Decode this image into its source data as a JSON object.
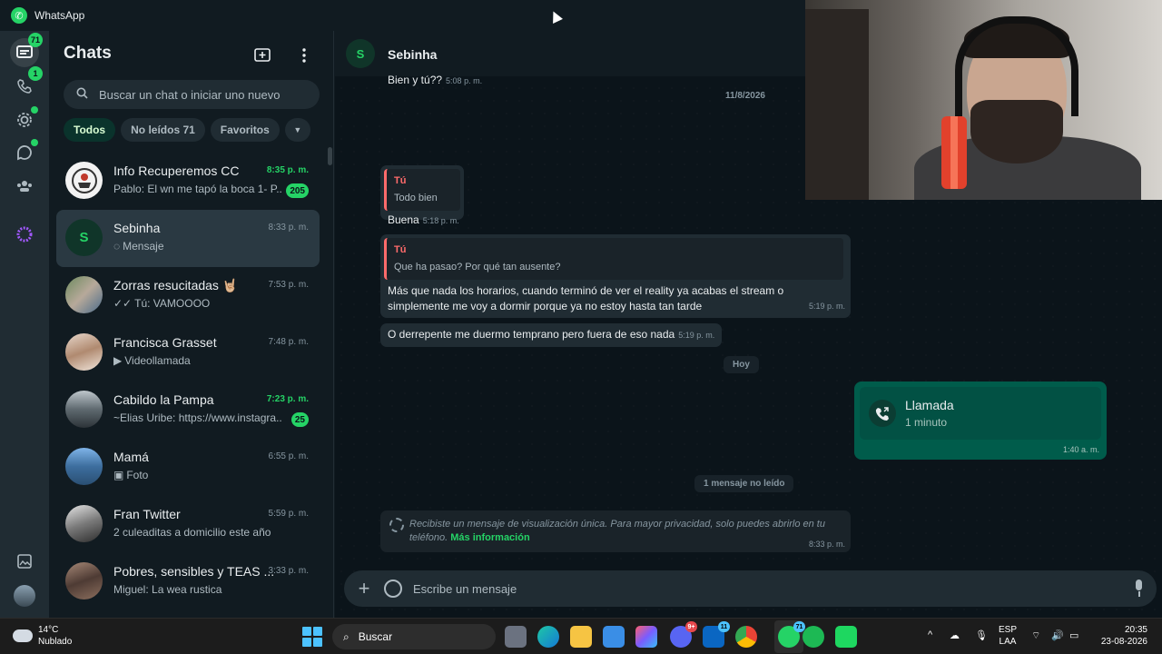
{
  "app": {
    "title": "WhatsApp"
  },
  "rail": {
    "items": [
      {
        "icon": "chats-icon",
        "badge": "71"
      },
      {
        "icon": "phone-icon",
        "badge": "1"
      },
      {
        "icon": "status-icon"
      },
      {
        "icon": "channels-icon"
      },
      {
        "icon": "communities-icon"
      },
      {
        "icon": "meta-ai-icon"
      },
      {
        "icon": "media-icon"
      }
    ]
  },
  "sidebar": {
    "title": "Chats",
    "search_placeholder": "Buscar un chat o iniciar uno nuevo",
    "filters": [
      "Todos",
      "No leídos 71",
      "Favoritos"
    ],
    "chats": [
      {
        "name": "Info Recuperemos CC",
        "time": "8:35 p. m.",
        "preview": "Pablo: El wn me tapó la boca 1- P...",
        "badge": "205",
        "unread": true
      },
      {
        "name": "Sebinha",
        "time": "8:33 p. m.",
        "preview": "Mensaje",
        "preview_icon": "◌",
        "selected": true,
        "letter": "S"
      },
      {
        "name": "Zorras resucitadas 🤘🏼",
        "time": "7:53 p. m.",
        "preview": "Tú: VAMOOOO",
        "preview_icon": "✓✓"
      },
      {
        "name": "Francisca Grasset",
        "time": "7:48 p. m.",
        "preview": "Videollamada",
        "preview_icon": "▶"
      },
      {
        "name": "Cabildo la Pampa",
        "time": "7:23 p. m.",
        "preview": "~Elias Uribe: https://www.instagra...",
        "badge": "25",
        "unread": true
      },
      {
        "name": "Mamá",
        "time": "6:55 p. m.",
        "preview": "Foto",
        "preview_icon": "▣"
      },
      {
        "name": "Fran Twitter",
        "time": "5:59 p. m.",
        "preview": "2 culeaditas a domicilio este año"
      },
      {
        "name": "Pobres, sensibles y TEAS ...",
        "time": "3:33 p. m.",
        "preview": "Miguel: La wea rustica"
      }
    ]
  },
  "conversation": {
    "contact_name": "Sebinha",
    "contact_letter": "S",
    "messages": {
      "m1_text": "Bien y tú??",
      "m1_time": "5:08 p. m.",
      "date1": "11/8/2026",
      "q1_author": "Tú",
      "q1_text": "Todo bien",
      "m2_text": "Buena",
      "m2_time": "5:18 p. m.",
      "q2_author": "Tú",
      "q2_text": "Que ha pasao? Por qué tan ausente?",
      "m3_text": "Más que nada los horarios, cuando terminó de ver el reality ya acabas el stream o simplemente me voy a dormir porque ya no estoy hasta tan tarde",
      "m3_time": "5:19 p. m.",
      "m4_text": "O derrepente me duermo temprano pero fuera de eso nada",
      "m4_time": "5:19 p. m.",
      "date2": "Hoy",
      "call_title": "Llamada",
      "call_duration": "1 minuto",
      "call_time": "1:40 a. m.",
      "unread_divider": "1 mensaje no leído",
      "view_once_text": "Recibiste un mensaje de visualización única. Para mayor privacidad, solo puedes abrirlo en tu teléfono.",
      "view_once_link": "Más información",
      "view_once_time": "8:33 p. m."
    },
    "composer_placeholder": "Escribe un mensaje"
  },
  "taskbar": {
    "weather_temp": "14°C",
    "weather_desc": "Nublado",
    "search_label": "Buscar",
    "discord_badge": "9+",
    "linkedin_badge": "11",
    "whatsapp_badge": "71",
    "lang_1": "ESP",
    "lang_2": "LAA",
    "time": "20:35",
    "date": "23-08-2026"
  },
  "colors": {
    "accent": "#25d366",
    "outgoing_bubble": "#005c4b",
    "background": "#0b141a"
  }
}
